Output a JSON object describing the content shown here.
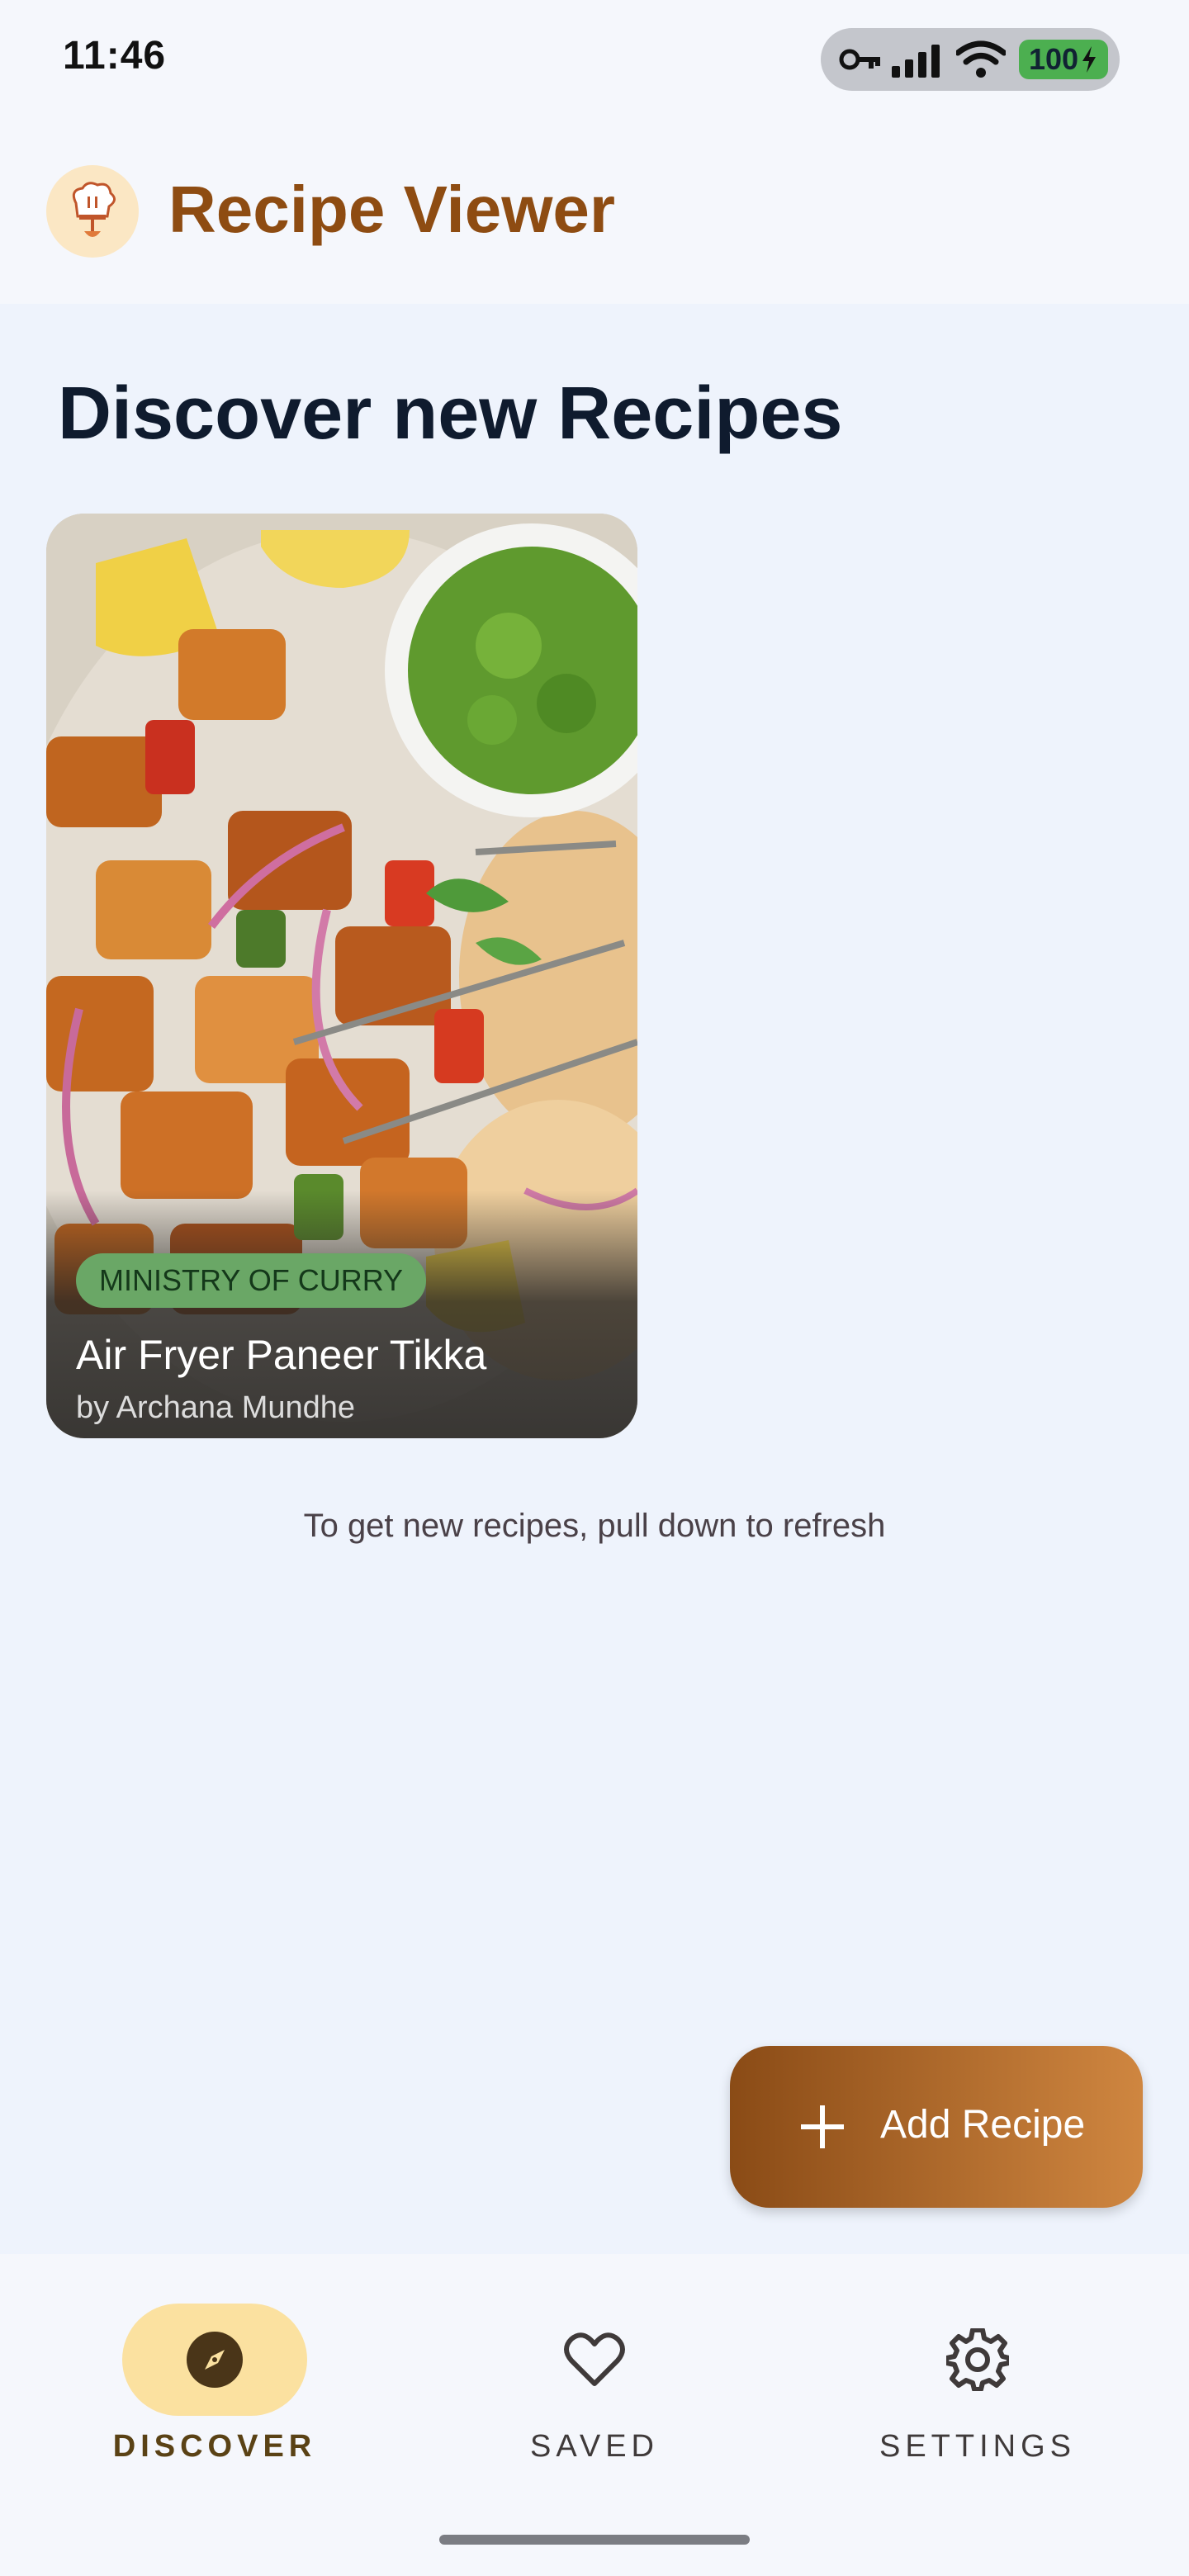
{
  "status_bar": {
    "time": "11:46",
    "battery": "100",
    "icons": [
      "vpn-key-icon",
      "cellular-signal-icon",
      "wifi-icon",
      "battery-charging-icon"
    ]
  },
  "app": {
    "title": "Recipe Viewer",
    "logo_icon": "chef-hat-icon"
  },
  "page": {
    "title": "Discover new Recipes",
    "hint": "To get new recipes, pull down to refresh"
  },
  "recipes": [
    {
      "source": "MINISTRY OF CURRY",
      "title": "Air Fryer Paneer Tikka",
      "author": "by Archana Mundhe"
    }
  ],
  "fab": {
    "label": "Add Recipe",
    "icon": "plus-icon"
  },
  "bottom_nav": {
    "items": [
      {
        "label": "DISCOVER",
        "icon": "compass-icon",
        "active": true
      },
      {
        "label": "SAVED",
        "icon": "heart-outline-icon",
        "active": false
      },
      {
        "label": "SETTINGS",
        "icon": "gear-icon",
        "active": false
      }
    ]
  },
  "colors": {
    "brand": "#8e4c12",
    "background": "#eef3fc",
    "tag": "#6aa766",
    "nav_active": "#fbe1a0"
  }
}
